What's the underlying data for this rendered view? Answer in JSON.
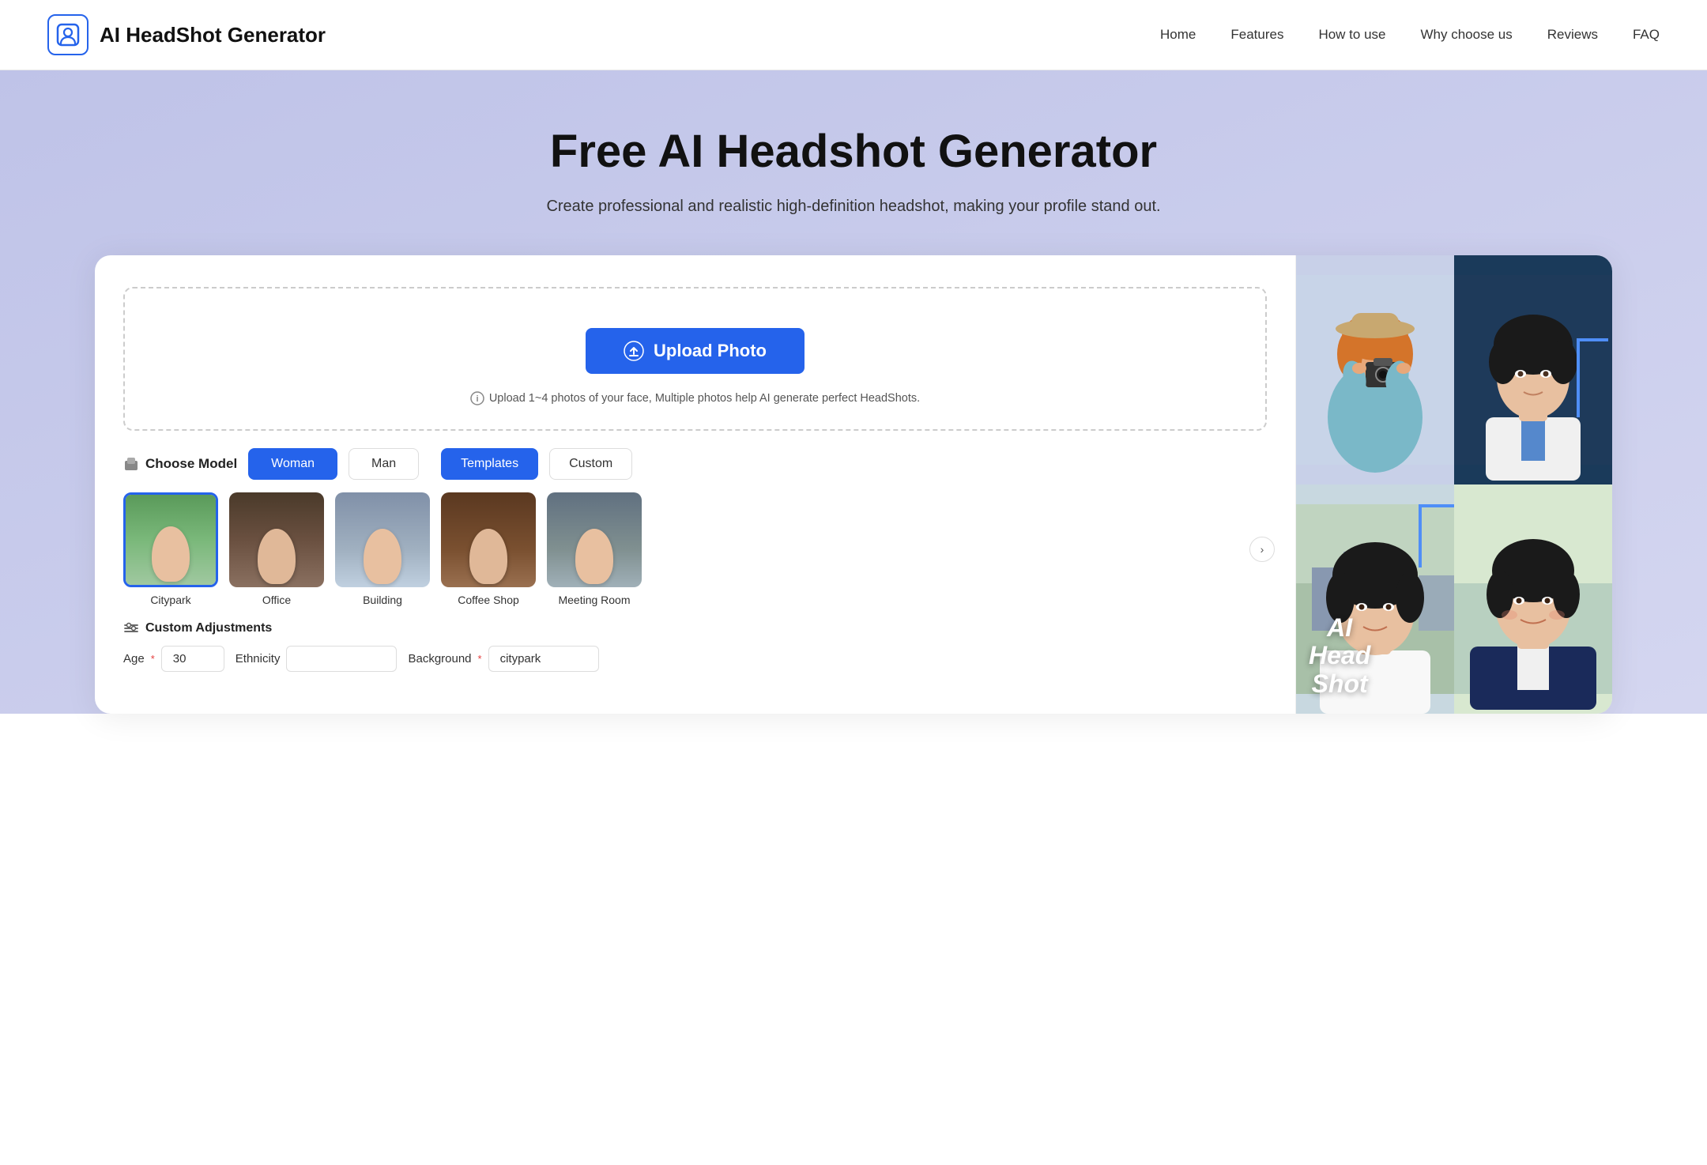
{
  "brand": {
    "title": "AI HeadShot Generator"
  },
  "nav": {
    "items": [
      {
        "label": "Home",
        "id": "home"
      },
      {
        "label": "Features",
        "id": "features"
      },
      {
        "label": "How to use",
        "id": "how-to-use"
      },
      {
        "label": "Why choose us",
        "id": "why-choose-us"
      },
      {
        "label": "Reviews",
        "id": "reviews"
      },
      {
        "label": "FAQ",
        "id": "faq"
      }
    ]
  },
  "hero": {
    "title": "Free AI Headshot Generator",
    "subtitle": "Create professional and realistic high-definition headshot, making your profile stand out."
  },
  "upload": {
    "button_label": "Upload Photo",
    "hint": "Upload 1~4 photos of your face, Multiple photos help AI generate perfect HeadShots."
  },
  "model": {
    "label": "Choose Model",
    "gender_options": [
      {
        "label": "Woman",
        "active": true
      },
      {
        "label": "Man",
        "active": false
      }
    ],
    "style_options": [
      {
        "label": "Templates",
        "active": true
      },
      {
        "label": "Custom",
        "active": false
      }
    ]
  },
  "templates": [
    {
      "name": "Citypark",
      "id": "citypark",
      "selected": true
    },
    {
      "name": "Office",
      "id": "office",
      "selected": false
    },
    {
      "name": "Building",
      "id": "building",
      "selected": false
    },
    {
      "name": "Coffee Shop",
      "id": "coffee-shop",
      "selected": false
    },
    {
      "name": "Meeting Room",
      "id": "meeting-room",
      "selected": false
    }
  ],
  "custom_adjustments": {
    "label": "Custom Adjustments",
    "fields": [
      {
        "label": "Age",
        "required": true,
        "value": "30",
        "id": "age"
      },
      {
        "label": "Ethnicity",
        "required": false,
        "value": "",
        "id": "ethnicity"
      },
      {
        "label": "Background",
        "required": true,
        "value": "citypark",
        "id": "background"
      }
    ]
  },
  "preview": {
    "ai_text_lines": [
      "AI",
      "Head",
      "Shot"
    ]
  }
}
